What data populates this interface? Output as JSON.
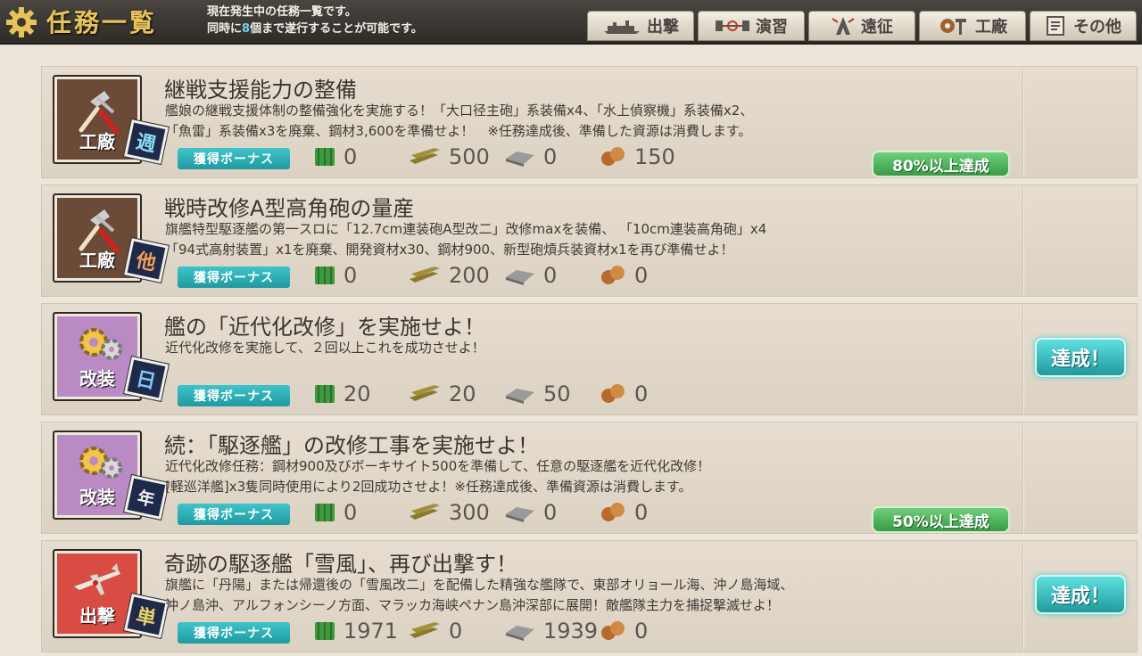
{
  "header": {
    "title": "任務一覧",
    "desc_line1": "現在発生中の任務一覧です。",
    "desc_line2_pre": "同時に",
    "desc_line2_num": "8",
    "desc_line2_post": "個まで遂行することが可能です。"
  },
  "nav": [
    {
      "label": "出撃",
      "icon": "fleet-icon"
    },
    {
      "label": "演習",
      "icon": "exercise-icon"
    },
    {
      "label": "遠征",
      "icon": "expedition-icon"
    },
    {
      "label": "工廠",
      "icon": "arsenal-icon"
    },
    {
      "label": "その他",
      "icon": "other-icon"
    }
  ],
  "bonus_label": "獲得ボーナス",
  "quests": [
    {
      "category": "工廠",
      "category_icon": "hammer-icon",
      "frequency": "週",
      "title": "継戦支援能力の整備",
      "desc1": "艦娘の継戦支援体制の整備強化を実施する！「大口径主砲」系装備x4、「水上偵察機」系装備x2、",
      "desc2": "「魚雷」系装備x3を廃棄、鋼材3,600を準備せよ！　※任務達成後、準備した資源は消費します。",
      "fuel": "0",
      "ammo": "500",
      "steel": "0",
      "bauxite": "150",
      "progress": "80%以上達成",
      "status": ""
    },
    {
      "category": "工廠",
      "category_icon": "hammer-icon",
      "frequency": "他",
      "title": "戦時改修A型高角砲の量産",
      "desc1": "旗艦特型駆逐艦の第一スロに「12.7cm連装砲A型改二」改修maxを装備、 「10cm連装高角砲」x4",
      "desc2": "「94式高射装置」x1を廃棄、開発資材x30、鋼材900、新型砲熕兵装資材x1を再び準備せよ！",
      "fuel": "0",
      "ammo": "200",
      "steel": "0",
      "bauxite": "0",
      "progress": "",
      "status": ""
    },
    {
      "category": "改装",
      "category_icon": "gears-icon",
      "frequency": "日",
      "title": "艦の「近代化改修」を実施せよ！",
      "desc1": "近代化改修を実施して、２回以上これを成功させよ！",
      "desc2": "",
      "fuel": "20",
      "ammo": "20",
      "steel": "50",
      "bauxite": "0",
      "progress": "",
      "status": "達成！"
    },
    {
      "category": "改装",
      "category_icon": "gears-icon",
      "frequency": "年",
      "title": "続：「駆逐艦」の改修工事を実施せよ！",
      "desc1": "近代化改修任務：鋼材900及びボーキサイト500を準備して、任意の駆逐艦を近代化改修！",
      "desc2": "[軽巡洋艦]x3隻同時使用により2回成功させよ！※任務達成後、準備資源は消費します。",
      "fuel": "0",
      "ammo": "300",
      "steel": "0",
      "bauxite": "0",
      "progress": "50%以上達成",
      "status": ""
    },
    {
      "category": "出撃",
      "category_icon": "plane-icon",
      "frequency": "単",
      "title": "奇跡の駆逐艦「雪風」、再び出撃す！",
      "desc1": "旗艦に「丹陽」または帰還後の「雪風改二」を配備した精強な艦隊で、東部オリョール海、沖ノ島海域、",
      "desc2": "沖ノ島沖、アルフォンシーノ方面、マラッカ海峡ペナン島沖深部に展開！敵艦隊主力を捕捉撃滅せよ！",
      "fuel": "1971",
      "ammo": "0",
      "steel": "1939",
      "bauxite": "0",
      "progress": "",
      "status": "達成！"
    }
  ],
  "colors": {
    "accent": "#e8c35a",
    "bonus": "#2bb2b8",
    "achieved": "#2fb8bb",
    "progress": "#4bb257"
  }
}
